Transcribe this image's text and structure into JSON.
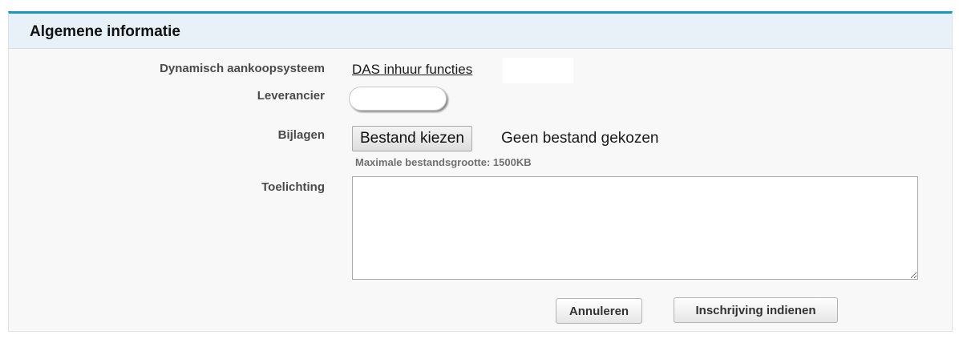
{
  "section": {
    "title": "Algemene informatie"
  },
  "fields": {
    "das_label": "Dynamisch aankoopsysteem",
    "das_value": "DAS inhuur functies",
    "supplier_label": "Leverancier",
    "supplier_value": "",
    "attachments_label": "Bijlagen",
    "file_button_label": "Bestand kiezen",
    "file_status": "Geen bestand gekozen",
    "file_hint": "Maximale bestandsgrootte: 1500KB",
    "remarks_label": "Toelichting",
    "remarks_value": ""
  },
  "actions": {
    "cancel_label": "Annuleren",
    "submit_label": "Inschrijving indienen"
  },
  "colors": {
    "accent": "#1797c0",
    "header_bg": "#e8f1f7",
    "panel_bg": "#f8f8f8"
  }
}
